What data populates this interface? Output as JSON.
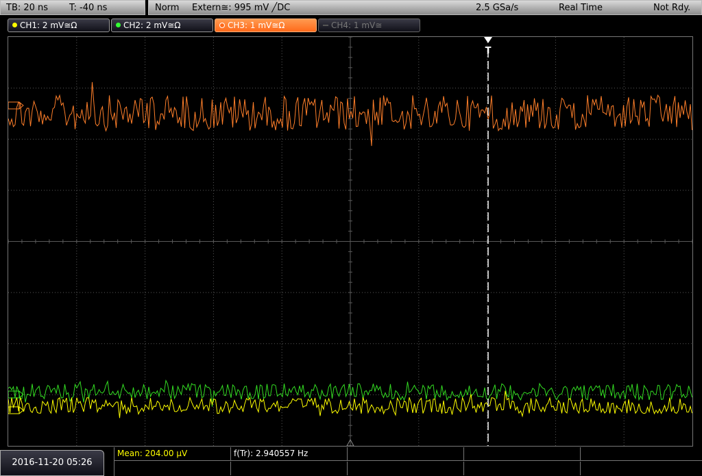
{
  "timebase": {
    "tb_label": "TB: 20 ns",
    "trigger_time_label": "T: -40 ns"
  },
  "acquisition": {
    "trigger_mode": "Norm",
    "trigger_source": "Extern≅: 995 mV ╱DC",
    "sample_rate": "2.5 GSa/s",
    "acq_mode": "Real Time",
    "status": "Not Rdy."
  },
  "channels": [
    {
      "label": "CH1: 2 mV≅Ω",
      "color": "#ffff00",
      "state": "on"
    },
    {
      "label": "CH2: 2 mV≅Ω",
      "color": "#33ff33",
      "state": "on"
    },
    {
      "label": "CH3: 1 mV≅Ω",
      "color": "#ff8a3d",
      "state": "active"
    },
    {
      "label": "CH4: 1 mV≅",
      "color": "#666666",
      "state": "off"
    }
  ],
  "screen": {
    "trigger_marker": "T",
    "grid_color": "#5a5a5a",
    "trace_colors": {
      "ch1": "#ffff00",
      "ch2": "#33dd22",
      "ch3": "#ff7f2a"
    }
  },
  "measurements": {
    "mean": "Mean: 204.00 µV",
    "freq": "f(Tr): 2.940557 Hz"
  },
  "footer": {
    "datetime": "2016-11-20 05:26"
  }
}
